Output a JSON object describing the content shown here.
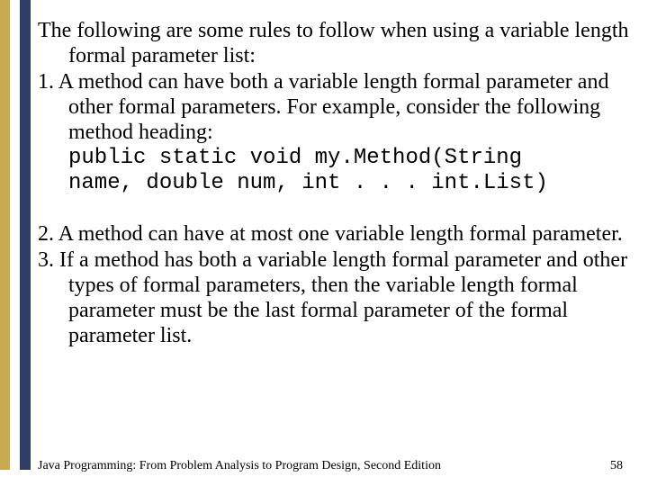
{
  "intro": "The following are some rules to follow when using a variable length formal parameter list:",
  "rules": [
    {
      "num": "1.",
      "text": "A method can have both a variable length formal parameter and other formal parameters. For example, consider the following method heading:"
    },
    {
      "num": "2.",
      "text": "A method can have at most one variable length formal parameter."
    },
    {
      "num": "3.",
      "text": "If a method has both a variable length formal parameter and other types of formal parameters, then the variable length formal parameter must be the last formal parameter of the formal parameter list."
    }
  ],
  "code_line1": "public static void my.Method(String",
  "code_line2": "name, double num, int . . . int.List)",
  "footer": {
    "title": "Java Programming: From Problem Analysis to Program Design, Second Edition",
    "page": "58"
  }
}
